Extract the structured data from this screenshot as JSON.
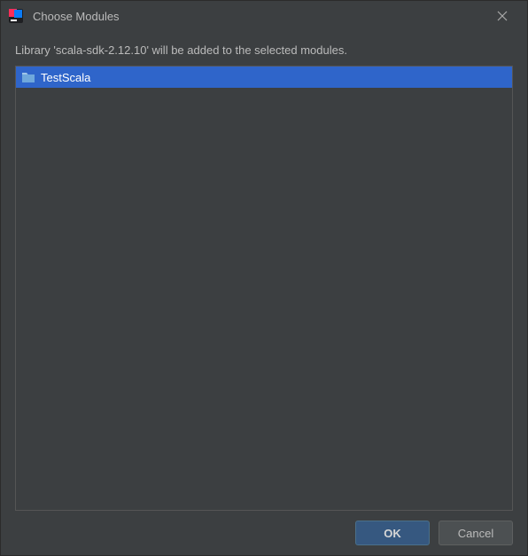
{
  "titlebar": {
    "title": "Choose Modules"
  },
  "instruction": "Library 'scala-sdk-2.12.10' will be added to the selected modules.",
  "modules": {
    "item0": {
      "label": "TestScala"
    }
  },
  "buttons": {
    "ok": "OK",
    "cancel": "Cancel"
  }
}
